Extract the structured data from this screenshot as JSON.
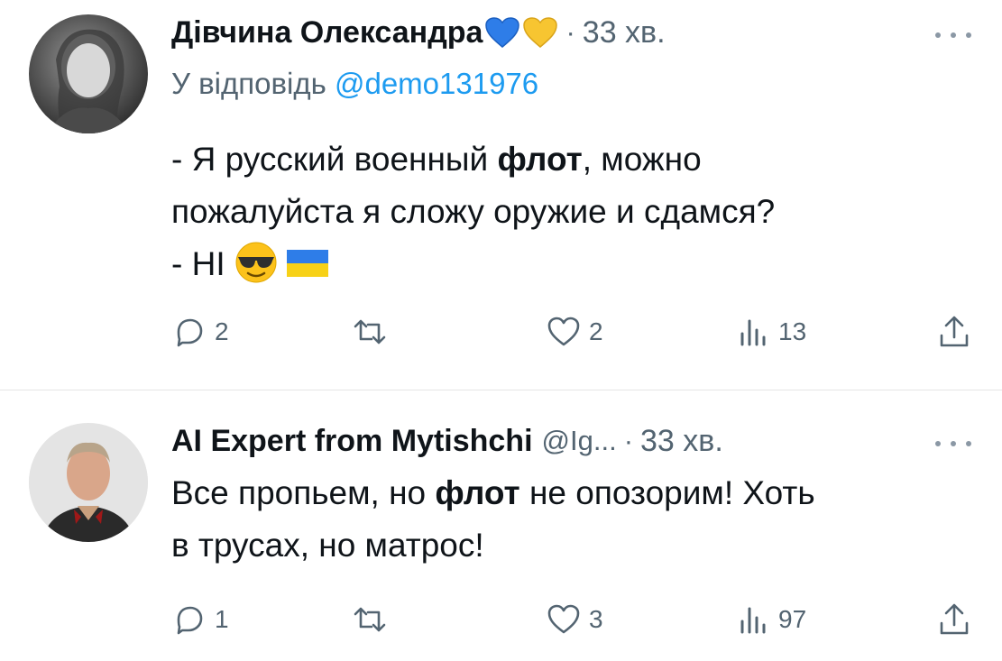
{
  "tweets": [
    {
      "author_name": "Дівчина Олександра",
      "hearts": [
        "blue-heart",
        "yellow-heart"
      ],
      "separator": "·",
      "time": "33 хв.",
      "reply_prefix": "У відповідь",
      "reply_mention": "@demo131976",
      "text_lines": [
        {
          "before": "- Я русский военный ",
          "bold": "флот",
          "after": ", можно"
        },
        {
          "before": "пожалуйста я сложу оружие и сдамся?",
          "bold": "",
          "after": ""
        },
        {
          "before": "- НІ",
          "bold": "",
          "after": ""
        }
      ],
      "emojis": [
        "smiling-face-with-sunglasses",
        "ukraine-flag"
      ],
      "actions": {
        "replies": "2",
        "retweets": "",
        "likes": "2",
        "views": "13"
      }
    },
    {
      "author_name": "AI Expert from Mytishchi",
      "handle": "@Ig...",
      "separator": "·",
      "time": "33 хв.",
      "text_lines": [
        {
          "before": "Все пропьем, но ",
          "bold": "флот",
          "after": " не опозорим! Хоть"
        },
        {
          "before": "в трусах, но матрос!",
          "bold": "",
          "after": ""
        }
      ],
      "actions": {
        "replies": "1",
        "retweets": "",
        "likes": "3",
        "views": "97"
      }
    }
  ],
  "colors": {
    "link": "#1d9bf0",
    "muted": "#536471",
    "text": "#0f1419"
  }
}
